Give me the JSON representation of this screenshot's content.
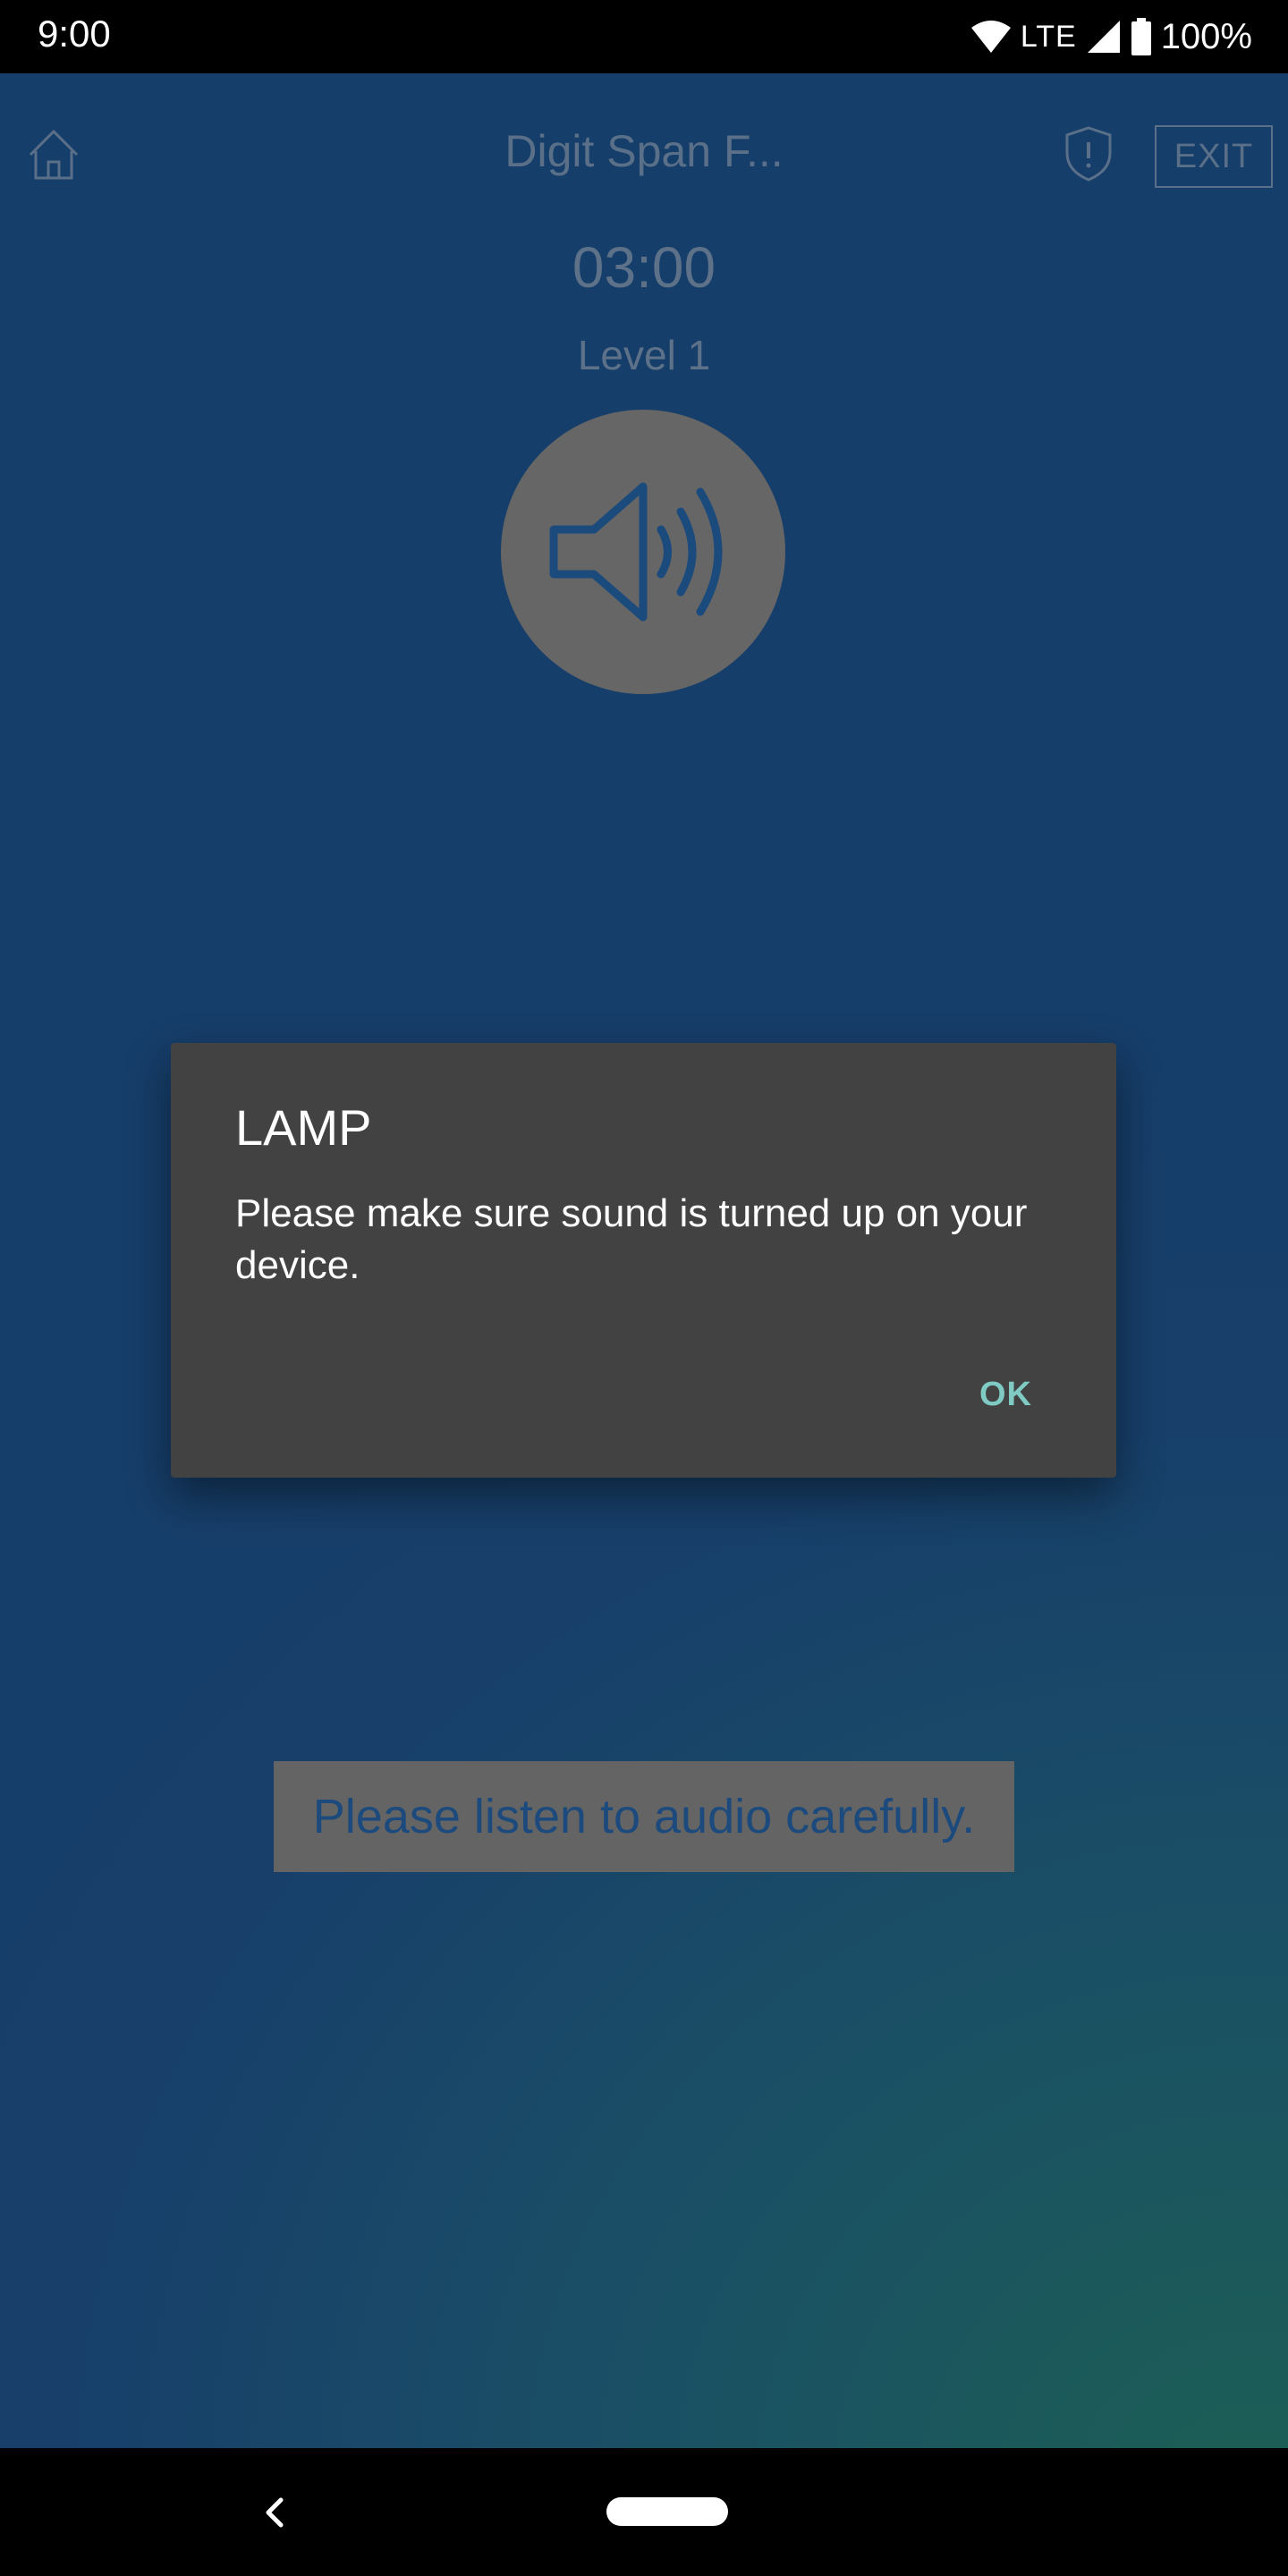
{
  "status_bar": {
    "time": "9:00",
    "network": "LTE",
    "battery": "100%"
  },
  "header": {
    "title": "Digit Span F...",
    "exit_label": "EXIT"
  },
  "game": {
    "timer": "03:00",
    "level": "Level 1",
    "instruction": "Please listen to audio carefully."
  },
  "dialog": {
    "title": "LAMP",
    "message": "Please make sure sound is turned up on your device.",
    "ok_label": "OK"
  },
  "colors": {
    "background": "#163e6a",
    "dialog": "#424242",
    "accent": "#7fcbc4",
    "muted_text": "#5a6f88"
  }
}
